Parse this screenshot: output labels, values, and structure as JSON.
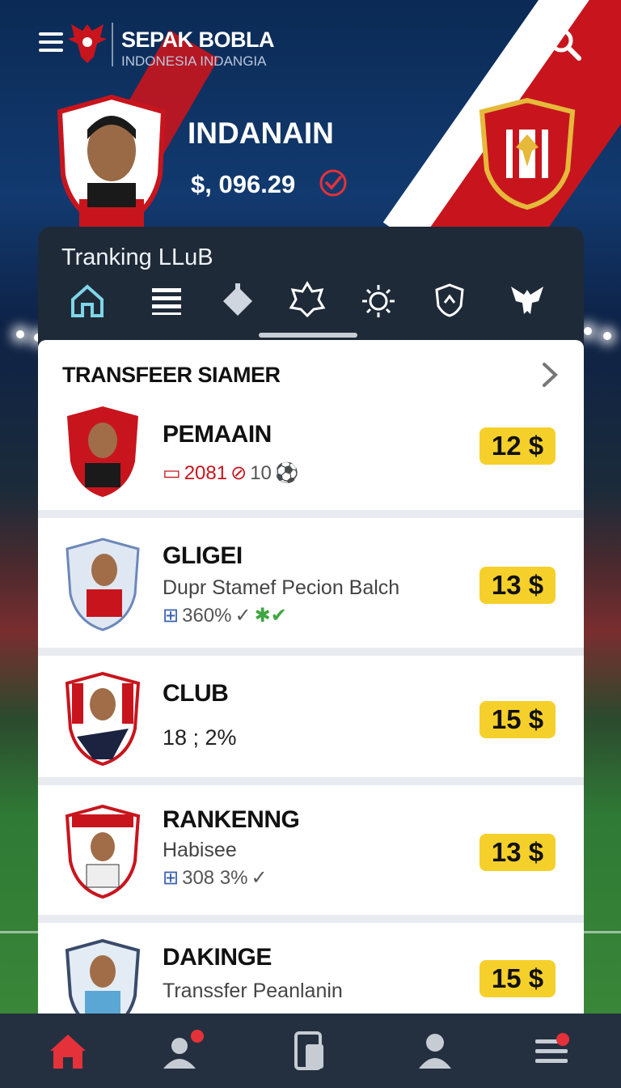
{
  "app": {
    "brand": "SEPAK BOBLA",
    "brand_sub": "INDONESIA INDANGIA"
  },
  "hero": {
    "name": "INDANAIN",
    "balance": "$, 096.29"
  },
  "panel": {
    "title": "Tranking LLuB",
    "nav_icons": [
      "home-icon",
      "list-icon",
      "spinning-top-icon",
      "badge-icon",
      "sun-icon",
      "shield-icon",
      "eagle-icon"
    ]
  },
  "section": {
    "title": "TRANSFEER SIAMER"
  },
  "rows": [
    {
      "name": "PEMAAIN",
      "sub": "",
      "meta_a": "2081",
      "meta_b": "10",
      "price": "12 $"
    },
    {
      "name": "GLIGEI",
      "sub": "Dupr Stamef Pecion Balch",
      "meta_a": "360%",
      "meta_b": "",
      "price": "13 $"
    },
    {
      "name": "CLUB",
      "sub": "18 ; 2%",
      "meta_a": "",
      "meta_b": "",
      "price": "15 $"
    },
    {
      "name": "RANKENNG",
      "sub": "Habisee",
      "meta_a": "308 3%",
      "meta_b": "",
      "price": "13 $"
    },
    {
      "name": "DAKINGE",
      "sub": "Transsfer Peanlanin",
      "meta_a": "",
      "meta_b": "",
      "price": "15 $"
    }
  ],
  "colors": {
    "accent_red": "#c8151d",
    "price_yellow": "#f6d02a",
    "panel_dark": "#1f2a38",
    "nav_bg": "#243040"
  },
  "bottom_nav": [
    "home-icon",
    "profile-icon",
    "document-icon",
    "user-icon",
    "menu-icon"
  ]
}
